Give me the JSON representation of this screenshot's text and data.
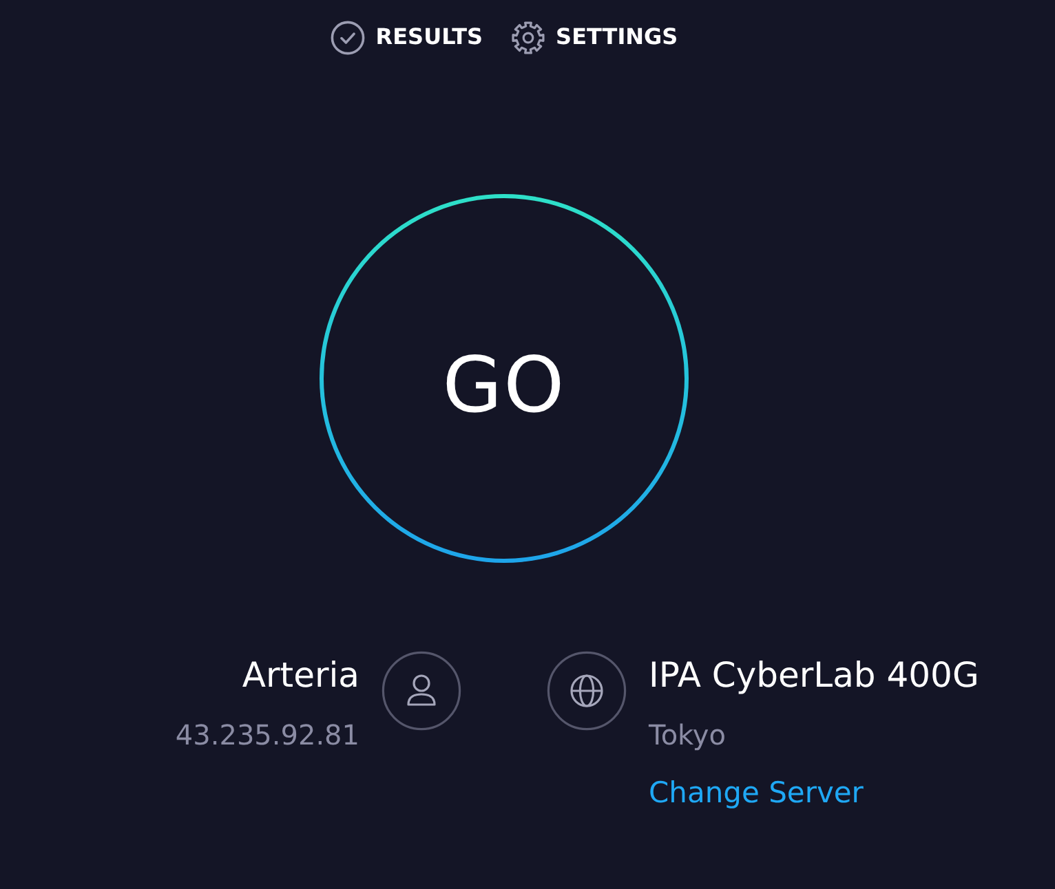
{
  "nav": [
    {
      "label": "RESULTS"
    },
    {
      "label": "SETTINGS"
    }
  ],
  "start_button": {
    "label": "GO"
  },
  "provider": {
    "name": "Arteria",
    "ip": "43.235.92.81"
  },
  "server": {
    "name": "IPA CyberLab 400G",
    "location": "Tokyo",
    "link": "Change Server"
  }
}
